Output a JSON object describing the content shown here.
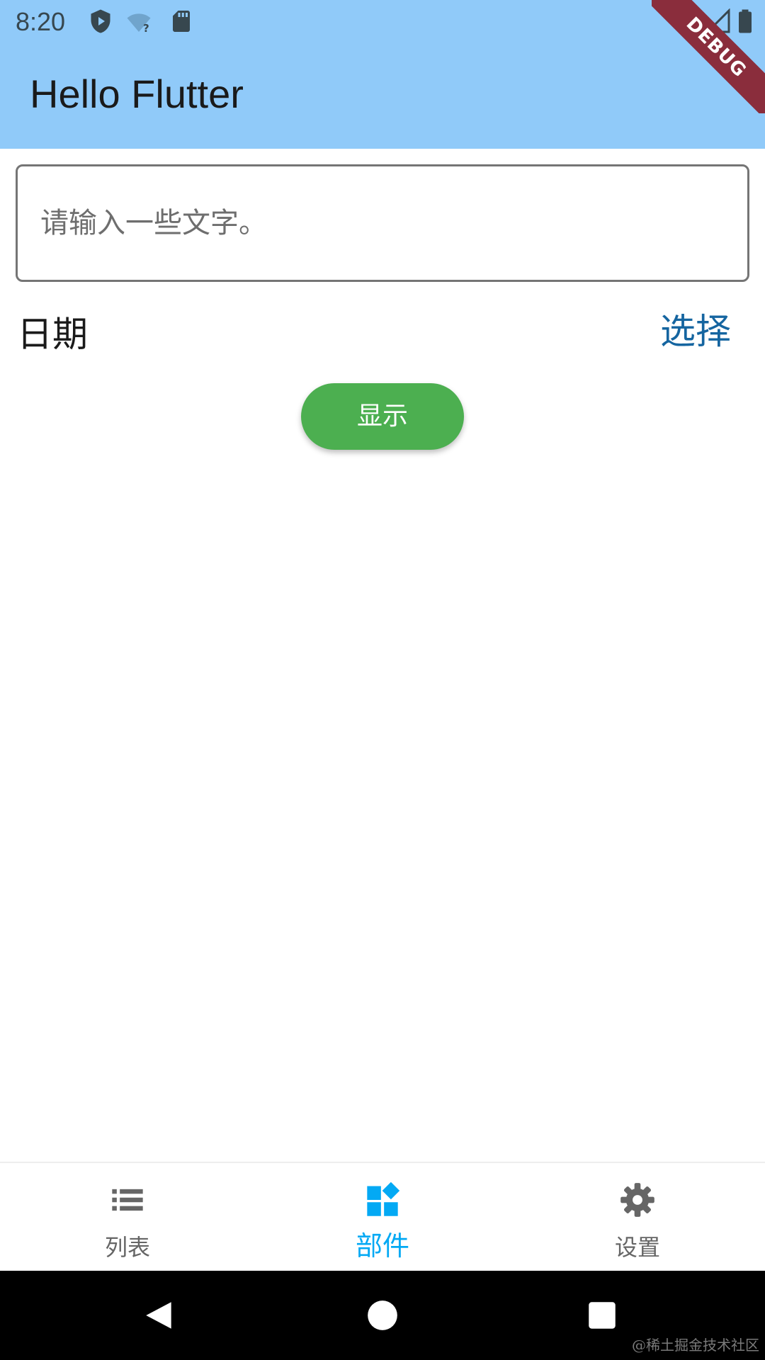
{
  "status_bar": {
    "time": "8:20",
    "icons": [
      "shield-play-icon",
      "wifi-question-icon",
      "sd-card-icon",
      "wifi-off-icon",
      "signal-icon",
      "battery-icon"
    ]
  },
  "debug_banner": {
    "label": "DEBUG",
    "color": "#8a2d3c"
  },
  "app_bar": {
    "title": "Hello Flutter",
    "background": "#90caf9"
  },
  "form": {
    "text_field": {
      "placeholder": "请输入一些文字。",
      "value": ""
    },
    "date_label": "日期",
    "select_label": "选择",
    "show_button_label": "显示",
    "show_button_color": "#4caf50"
  },
  "bottom_nav": {
    "active_color": "#03a9f4",
    "inactive_color": "#666666",
    "items": [
      {
        "label": "列表",
        "icon": "list-icon",
        "active": false
      },
      {
        "label": "部件",
        "icon": "widgets-icon",
        "active": true
      },
      {
        "label": "设置",
        "icon": "settings-icon",
        "active": false
      }
    ]
  },
  "system_nav": {
    "buttons": [
      "back-icon",
      "home-icon",
      "recents-icon"
    ]
  },
  "watermark": "@稀土掘金技术社区"
}
